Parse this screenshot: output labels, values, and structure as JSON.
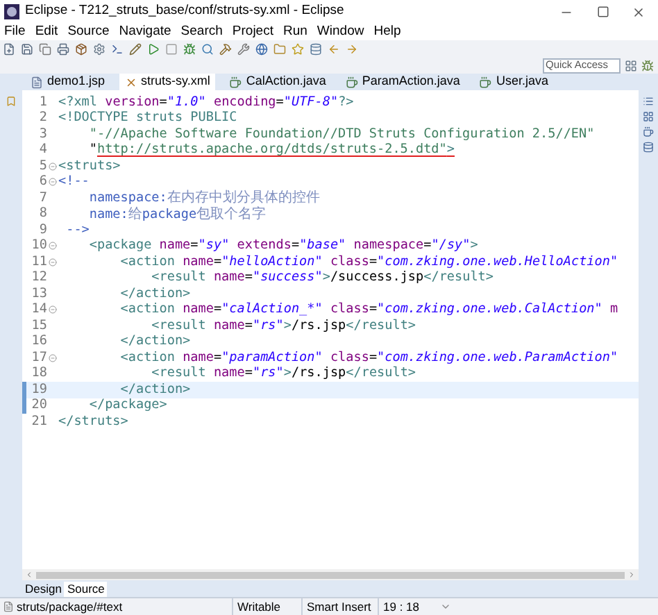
{
  "window": {
    "title": "Eclipse - T212_struts_base/conf/struts-sy.xml - Eclipse"
  },
  "menu": [
    "File",
    "Edit",
    "Source",
    "Navigate",
    "Search",
    "Project",
    "Run",
    "Window",
    "Help"
  ],
  "quick_access": {
    "placeholder": "Quick Access"
  },
  "tabs": [
    {
      "label": "demo1.jsp",
      "kind": "jsp",
      "selected": false
    },
    {
      "label": "struts-sy.xml",
      "kind": "xml",
      "selected": true
    },
    {
      "label": "CalAction.java",
      "kind": "java",
      "selected": false
    },
    {
      "label": "ParamAction.java",
      "kind": "java",
      "selected": false
    },
    {
      "label": "User.java",
      "kind": "java",
      "selected": false
    }
  ],
  "editor": {
    "lines": [
      {
        "number": "1",
        "foldable": false,
        "current": false,
        "marked": false,
        "segments": [
          {
            "kind": "tag",
            "text": "<?xml"
          },
          {
            "kind": "attr",
            "text": " version"
          },
          {
            "kind": "plain",
            "text": "="
          },
          {
            "kind": "value",
            "text": "\"1.0\""
          },
          {
            "kind": "attr",
            "text": " encoding"
          },
          {
            "kind": "plain",
            "text": "="
          },
          {
            "kind": "value",
            "text": "\"UTF-8\""
          },
          {
            "kind": "tag",
            "text": "?>"
          }
        ]
      },
      {
        "number": "2",
        "foldable": false,
        "current": false,
        "marked": false,
        "segments": [
          {
            "kind": "tag",
            "text": "<!DOCTYPE struts PUBLIC"
          }
        ]
      },
      {
        "number": "3",
        "foldable": false,
        "current": false,
        "marked": false,
        "segments": [
          {
            "kind": "doctype",
            "text": "    \"-//Apache Software Foundation//DTD Struts Configuration 2.5//EN\""
          }
        ]
      },
      {
        "number": "4",
        "foldable": false,
        "current": false,
        "marked": false,
        "segments": [
          {
            "kind": "plain",
            "text": "    \""
          },
          {
            "kind": "doctype",
            "text": "http://struts.apache.org/dtds/struts-2.5.dtd\"",
            "underlined": true
          },
          {
            "kind": "tag",
            "text": ">",
            "underlined": true
          }
        ]
      },
      {
        "number": "5",
        "foldable": true,
        "current": false,
        "marked": false,
        "segments": [
          {
            "kind": "tag",
            "text": "<struts>"
          }
        ]
      },
      {
        "number": "6",
        "foldable": true,
        "current": false,
        "marked": false,
        "segments": [
          {
            "kind": "comment",
            "text": "<!--"
          }
        ]
      },
      {
        "number": "7",
        "foldable": false,
        "current": false,
        "marked": false,
        "segments": [
          {
            "kind": "comment",
            "text": "    namespace:"
          },
          {
            "kind": "cjk",
            "text": "在内存中划分具体的控件"
          }
        ]
      },
      {
        "number": "8",
        "foldable": false,
        "current": false,
        "marked": false,
        "segments": [
          {
            "kind": "comment",
            "text": "    name:"
          },
          {
            "kind": "cjk",
            "text": "给"
          },
          {
            "kind": "comment",
            "text": "package"
          },
          {
            "kind": "cjk",
            "text": "包取个名字"
          }
        ]
      },
      {
        "number": "9",
        "foldable": false,
        "current": false,
        "marked": false,
        "segments": [
          {
            "kind": "comment",
            "text": " -->"
          }
        ]
      },
      {
        "number": "10",
        "foldable": true,
        "current": false,
        "marked": false,
        "segments": [
          {
            "kind": "tag",
            "text": "    <package"
          },
          {
            "kind": "attr",
            "text": " name"
          },
          {
            "kind": "plain",
            "text": "="
          },
          {
            "kind": "value",
            "text": "\"sy\""
          },
          {
            "kind": "attr",
            "text": " extends"
          },
          {
            "kind": "plain",
            "text": "="
          },
          {
            "kind": "value",
            "text": "\"base\""
          },
          {
            "kind": "attr",
            "text": " namespace"
          },
          {
            "kind": "plain",
            "text": "="
          },
          {
            "kind": "value",
            "text": "\"/sy\""
          },
          {
            "kind": "tag",
            "text": ">"
          }
        ]
      },
      {
        "number": "11",
        "foldable": true,
        "current": false,
        "marked": false,
        "segments": [
          {
            "kind": "tag",
            "text": "        <action"
          },
          {
            "kind": "attr",
            "text": " name"
          },
          {
            "kind": "plain",
            "text": "="
          },
          {
            "kind": "value",
            "text": "\"helloAction\""
          },
          {
            "kind": "attr",
            "text": " class"
          },
          {
            "kind": "plain",
            "text": "="
          },
          {
            "kind": "value",
            "text": "\"com.zking.one.web.HelloAction\""
          }
        ]
      },
      {
        "number": "12",
        "foldable": false,
        "current": false,
        "marked": false,
        "segments": [
          {
            "kind": "tag",
            "text": "            <result"
          },
          {
            "kind": "attr",
            "text": " name"
          },
          {
            "kind": "plain",
            "text": "="
          },
          {
            "kind": "value",
            "text": "\"success\""
          },
          {
            "kind": "tag",
            "text": ">"
          },
          {
            "kind": "plain",
            "text": "/success.jsp"
          },
          {
            "kind": "tag",
            "text": "</result>"
          }
        ]
      },
      {
        "number": "13",
        "foldable": false,
        "current": false,
        "marked": false,
        "segments": [
          {
            "kind": "tag",
            "text": "        </action>"
          }
        ]
      },
      {
        "number": "14",
        "foldable": true,
        "current": false,
        "marked": false,
        "segments": [
          {
            "kind": "tag",
            "text": "        <action"
          },
          {
            "kind": "attr",
            "text": " name"
          },
          {
            "kind": "plain",
            "text": "="
          },
          {
            "kind": "value",
            "text": "\"calAction_*\""
          },
          {
            "kind": "attr",
            "text": " class"
          },
          {
            "kind": "plain",
            "text": "="
          },
          {
            "kind": "value",
            "text": "\"com.zking.one.web.CalAction\""
          },
          {
            "kind": "attr",
            "text": " m"
          }
        ]
      },
      {
        "number": "15",
        "foldable": false,
        "current": false,
        "marked": false,
        "segments": [
          {
            "kind": "tag",
            "text": "            <result"
          },
          {
            "kind": "attr",
            "text": " name"
          },
          {
            "kind": "plain",
            "text": "="
          },
          {
            "kind": "value",
            "text": "\"rs\""
          },
          {
            "kind": "tag",
            "text": ">"
          },
          {
            "kind": "plain",
            "text": "/rs.jsp"
          },
          {
            "kind": "tag",
            "text": "</result>"
          }
        ]
      },
      {
        "number": "16",
        "foldable": false,
        "current": false,
        "marked": false,
        "segments": [
          {
            "kind": "tag",
            "text": "        </action>"
          }
        ]
      },
      {
        "number": "17",
        "foldable": true,
        "current": false,
        "marked": false,
        "segments": [
          {
            "kind": "tag",
            "text": "        <action"
          },
          {
            "kind": "attr",
            "text": " name"
          },
          {
            "kind": "plain",
            "text": "="
          },
          {
            "kind": "value",
            "text": "\"paramAction\""
          },
          {
            "kind": "attr",
            "text": " class"
          },
          {
            "kind": "plain",
            "text": "="
          },
          {
            "kind": "value",
            "text": "\"com.zking.one.web.ParamAction\""
          }
        ]
      },
      {
        "number": "18",
        "foldable": false,
        "current": false,
        "marked": false,
        "segments": [
          {
            "kind": "tag",
            "text": "            <result"
          },
          {
            "kind": "attr",
            "text": " name"
          },
          {
            "kind": "plain",
            "text": "="
          },
          {
            "kind": "value",
            "text": "\"rs\""
          },
          {
            "kind": "tag",
            "text": ">"
          },
          {
            "kind": "plain",
            "text": "/rs.jsp"
          },
          {
            "kind": "tag",
            "text": "</result>"
          }
        ]
      },
      {
        "number": "19",
        "foldable": false,
        "current": true,
        "marked": true,
        "segments": [
          {
            "kind": "tag",
            "text": "        </action>"
          }
        ]
      },
      {
        "number": "20",
        "foldable": false,
        "current": false,
        "marked": true,
        "segments": [
          {
            "kind": "tag",
            "text": "    </package>"
          }
        ]
      },
      {
        "number": "21",
        "foldable": false,
        "current": false,
        "marked": false,
        "segments": [
          {
            "kind": "tag",
            "text": "</struts>"
          }
        ]
      }
    ]
  },
  "view_tabs": [
    {
      "label": "Design",
      "selected": false
    },
    {
      "label": "Source",
      "selected": true
    }
  ],
  "status_bar": {
    "path": "struts/package/#text",
    "mode": "Writable",
    "insert": "Smart Insert",
    "position": "19 : 18"
  }
}
